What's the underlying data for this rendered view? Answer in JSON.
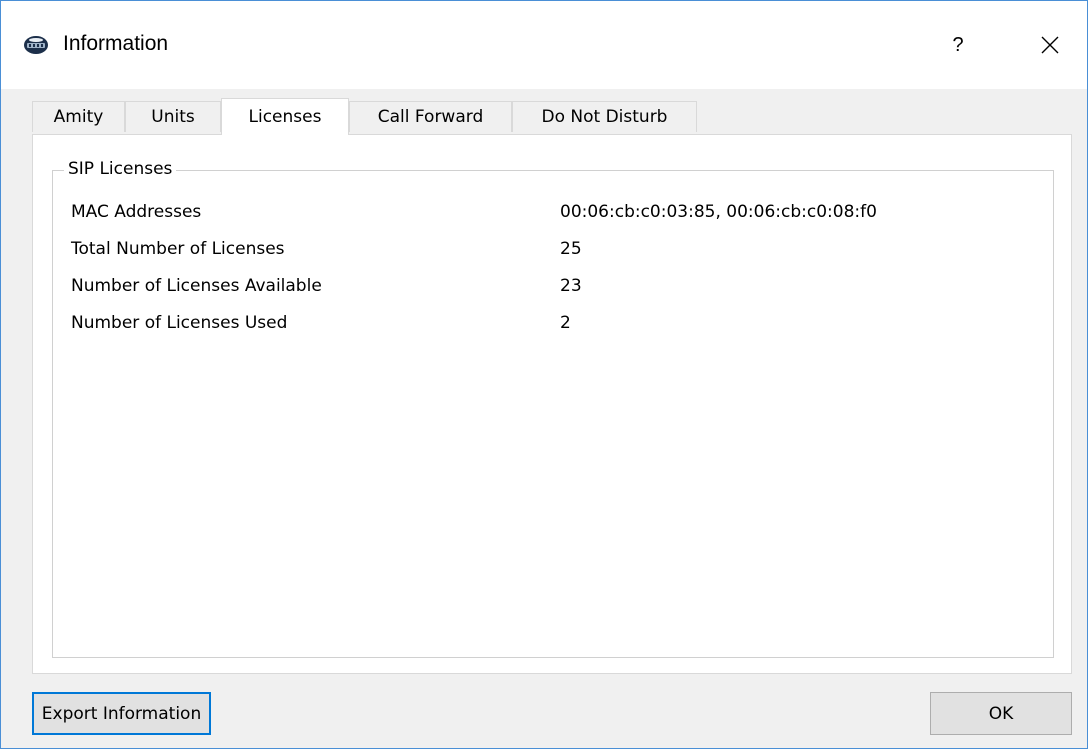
{
  "window": {
    "title": "Information",
    "help_label": "?",
    "icon": "phone-system-icon",
    "close_icon": "close-icon"
  },
  "tabs": [
    {
      "label": "Amity",
      "active": false
    },
    {
      "label": "Units",
      "active": false
    },
    {
      "label": "Licenses",
      "active": true
    },
    {
      "label": "Call Forward",
      "active": false
    },
    {
      "label": "Do Not Disturb",
      "active": false
    }
  ],
  "sip_licenses": {
    "group_title": "SIP Licenses",
    "rows": [
      {
        "label": "MAC Addresses",
        "value": "00:06:cb:c0:03:85,  00:06:cb:c0:08:f0"
      },
      {
        "label": "Total Number of Licenses",
        "value": "25"
      },
      {
        "label": "Number of Licenses Available",
        "value": "23"
      },
      {
        "label": "Number of Licenses Used",
        "value": "2"
      }
    ]
  },
  "buttons": {
    "export_label": "Export Information",
    "ok_label": "OK"
  },
  "colors": {
    "window_border": "#4a8fd6",
    "focus_border": "#0078d7",
    "dialog_bg": "#f0f0f0",
    "button_bg": "#e1e1e1"
  }
}
